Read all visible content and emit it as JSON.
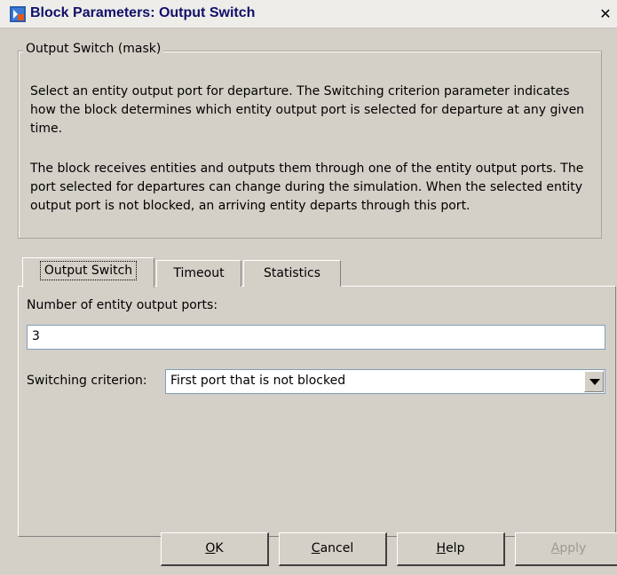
{
  "window": {
    "title": "Block Parameters: Output Switch",
    "close_label": "✕"
  },
  "mask": {
    "legend": "Output Switch (mask)",
    "desc1": "Select an entity output port for departure. The Switching criterion parameter indicates how the block determines which entity output port is selected for departure at any given time.",
    "desc2": "The block receives entities and outputs them through one of the entity output ports. The port selected for departures can change during the simulation. When the selected entity output port is not blocked, an arriving entity departs through this port."
  },
  "tabs": [
    {
      "label": "Output Switch",
      "active": true
    },
    {
      "label": "Timeout",
      "active": false
    },
    {
      "label": "Statistics",
      "active": false
    }
  ],
  "form": {
    "ports_label": "Number of entity output ports:",
    "ports_value": "3",
    "switching_label": "Switching criterion:",
    "switching_value": "First port that is not blocked"
  },
  "buttons": {
    "ok": {
      "mnemonic": "O",
      "rest": "K"
    },
    "cancel": {
      "mnemonic": "C",
      "rest": "ancel"
    },
    "help": {
      "mnemonic": "H",
      "rest": "elp"
    },
    "apply": {
      "mnemonic": "A",
      "rest": "pply",
      "disabled": true
    }
  },
  "icons": {
    "title": "simulink-block-icon",
    "dropdown": "chevron-down-icon"
  }
}
